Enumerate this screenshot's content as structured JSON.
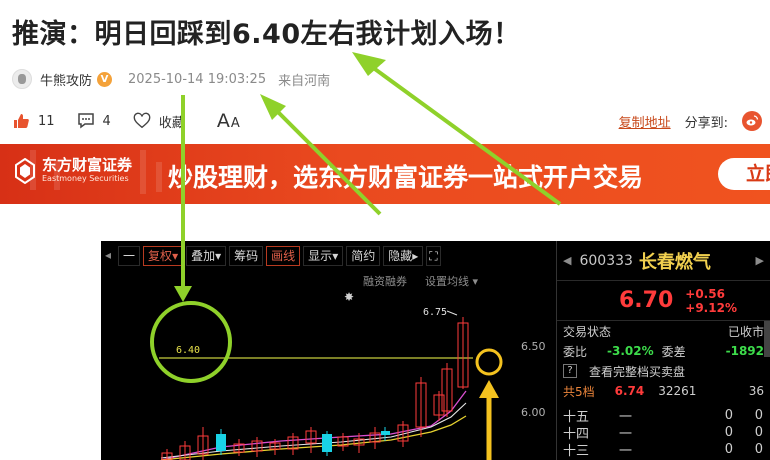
{
  "article": {
    "title": "推演：明日回踩到6.40左右我计划入场！",
    "author": "牛熊攻防",
    "verified_badge": "V",
    "date": "2025-10-14 19:03:25",
    "location": "来自河南"
  },
  "actions": {
    "likes": "11",
    "comments": "4",
    "favorite_label": "收藏",
    "font_label_big": "A",
    "font_label_small": "A",
    "copy_link": "复制地址",
    "share_label": "分享到:"
  },
  "banner": {
    "logo_cn": "东方财富证券",
    "logo_en": "Eastmoney Securities",
    "text": "炒股理财，选东方财富证券一站式开户交易",
    "button": "立即"
  },
  "stock_app": {
    "toolbar": [
      "一",
      "复权",
      "叠加",
      "筹码",
      "画线",
      "显示",
      "简约",
      "隐藏"
    ],
    "sub_links": [
      "融资融券",
      "设置均线"
    ],
    "chart_labels": {
      "support_level": "6.40",
      "high_label": "6.75",
      "axis_6_50": "6.50",
      "axis_6_00": "6.00"
    },
    "panel": {
      "code": "600333",
      "name": "长春燃气",
      "price": "6.70",
      "change": "+0.56",
      "change_pct": "+9.12%",
      "status_label": "交易状态",
      "status_value": "已收市",
      "weibi_label": "委比",
      "weibi_value": "-3.02%",
      "weicha_label": "委差",
      "weicha_value": "-1892",
      "full_book": "查看完整档买卖盘",
      "total_label": "共5档",
      "total_price": "6.74",
      "total_vol": "32261",
      "total_count": "36",
      "levels": [
        {
          "name": "十五",
          "price": "一",
          "vol": "0",
          "count": "0"
        },
        {
          "name": "十四",
          "price": "一",
          "vol": "0",
          "count": "0"
        },
        {
          "name": "十三",
          "price": "一",
          "vol": "0",
          "count": "0"
        }
      ]
    }
  },
  "colors": {
    "annotation_green": "#8fd12a",
    "annotation_yellow": "#f4c21f",
    "banner_red": "#e8401b",
    "stock_up": "#ff3b3b",
    "stock_down": "#19d3e6",
    "stock_name": "#f1d04f"
  }
}
